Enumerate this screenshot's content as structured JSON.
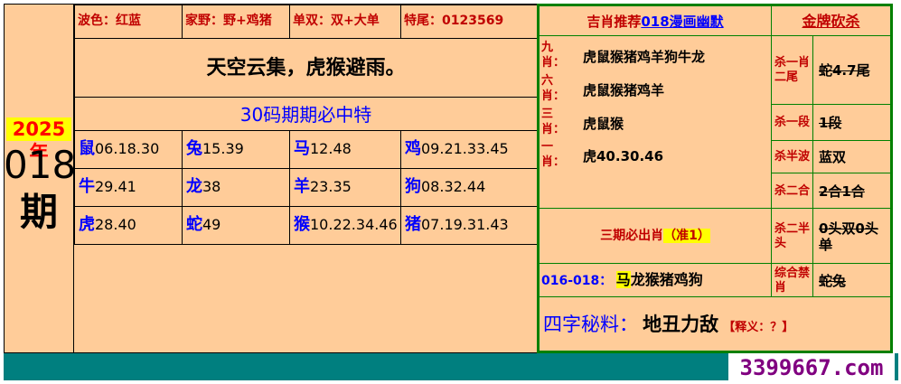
{
  "period": {
    "year_label": "2025年",
    "number": "018",
    "char": "期"
  },
  "info_row": {
    "wave": "波色：红蓝",
    "family": "家野：野+鸡猪",
    "oddeven": "单双：双+大单",
    "tail": "特尾：0123569"
  },
  "poem": "天空云集，虎猴避雨。",
  "banner": "30码期期必中特",
  "zodiac_table": [
    [
      {
        "z": "鼠",
        "n": "06.18.30"
      },
      {
        "z": "兔",
        "n": "15.39"
      },
      {
        "z": "马",
        "n": "12.48"
      },
      {
        "z": "鸡",
        "n": "09.21.33.45"
      }
    ],
    [
      {
        "z": "牛",
        "n": "29.41"
      },
      {
        "z": "龙",
        "n": "38"
      },
      {
        "z": "羊",
        "n": "23.35"
      },
      {
        "z": "狗",
        "n": "08.32.44"
      }
    ],
    [
      {
        "z": "虎",
        "n": "28.40"
      },
      {
        "z": "蛇",
        "n": "49"
      },
      {
        "z": "猴",
        "n": "10.22.34.46"
      },
      {
        "z": "猪",
        "n": "07.19.31.43"
      }
    ]
  ],
  "right": {
    "header_left_prefix": "吉肖推荐",
    "header_left_link": "018漫画幽默",
    "header_right": "金牌砍杀",
    "picks": [
      {
        "label": "九肖：",
        "value": "虎鼠猴猪鸡羊狗牛龙"
      },
      {
        "label": "六肖：",
        "value": "虎鼠猴猪鸡羊"
      },
      {
        "label": "三肖：",
        "value": "虎鼠猴"
      },
      {
        "label": "一肖：",
        "value": "虎40.30.46"
      }
    ],
    "kills": [
      {
        "label": "杀一肖二尾",
        "value": "蛇4.7尾"
      },
      {
        "label": "杀一段",
        "value": "1段"
      },
      {
        "label": "杀半波",
        "value": "蓝双"
      },
      {
        "label": "杀二合",
        "value": "2合1合"
      },
      {
        "label": "杀二半头",
        "value": "0头双0头单"
      },
      {
        "label": "综合禁肖",
        "value": "蛇兔"
      }
    ],
    "three_period": "三期必出肖",
    "three_period_tag": "（准1）",
    "range_label": "016-018：",
    "range_hit": "马",
    "range_rest": "龙猴猪鸡狗",
    "four_label": "四字秘料：",
    "four_value": "地丑力敌",
    "four_note": "【释义：？】"
  },
  "site": "3399667.com"
}
